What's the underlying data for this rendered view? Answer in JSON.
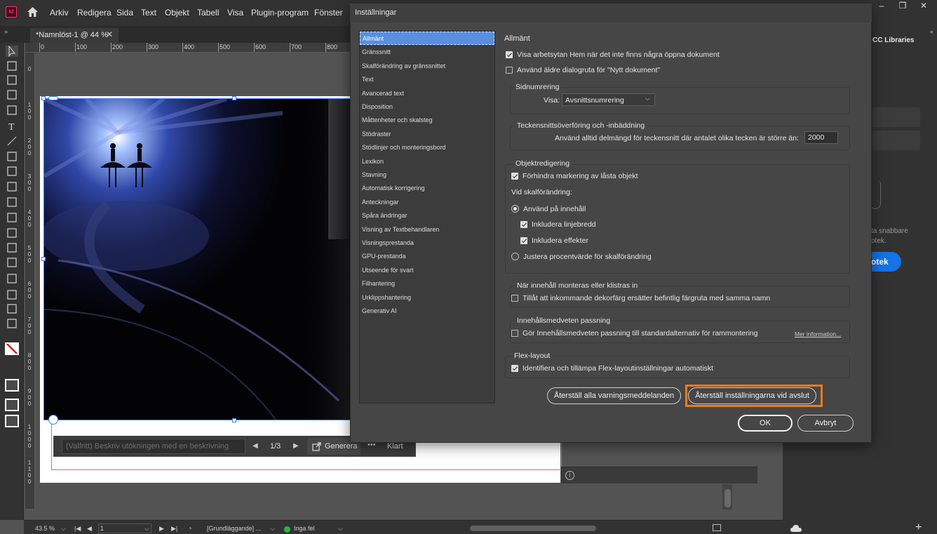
{
  "app": {
    "logo_text": "Id",
    "menus": [
      "Arkiv",
      "Redigera",
      "Sida",
      "Text",
      "Objekt",
      "Tabell",
      "Visa",
      "Plugin-program",
      "Fönster"
    ],
    "window_controls": [
      "–",
      "❐",
      "✕"
    ]
  },
  "doc_tab": {
    "label": "*Namnlöst-1 @ 44 %",
    "close": "✕"
  },
  "rulers": {
    "top": [
      "0",
      "100",
      "200",
      "300",
      "400",
      "500",
      "600",
      "700",
      "800"
    ],
    "left_labels": [
      {
        "label": "0",
        "digits": [
          "0"
        ]
      },
      {
        "label": "100",
        "digits": [
          "1",
          "0",
          "0"
        ]
      },
      {
        "label": "200",
        "digits": [
          "2",
          "0",
          "0"
        ]
      },
      {
        "label": "300",
        "digits": [
          "3",
          "0",
          "0"
        ]
      },
      {
        "label": "400",
        "digits": [
          "4",
          "0",
          "0"
        ]
      },
      {
        "label": "500",
        "digits": [
          "5",
          "0",
          "0"
        ]
      },
      {
        "label": "600",
        "digits": [
          "6",
          "0",
          "0"
        ]
      },
      {
        "label": "700",
        "digits": [
          "7",
          "0",
          "0"
        ]
      },
      {
        "label": "800",
        "digits": [
          "8",
          "0",
          "0"
        ]
      },
      {
        "label": "900",
        "digits": [
          "9",
          "0",
          "0"
        ]
      },
      {
        "label": "1000",
        "digits": [
          "1",
          "0",
          "0",
          "0"
        ]
      },
      {
        "label": "1100",
        "digits": [
          "1",
          "1",
          "0",
          "0"
        ]
      }
    ]
  },
  "gen_bar": {
    "placeholder": "(Valfritt) Beskriv utökningen med en beskrivning",
    "page_indicator": "1/3",
    "generate_label": "Generera",
    "more": "•••",
    "done_label": "Klart"
  },
  "right_panel": {
    "tab_label": "CC Libraries",
    "text_line1": "ta snabbare",
    "text_line2": "otek.",
    "button_label": "otek"
  },
  "statusbar": {
    "zoom": "43.5 %",
    "page": "1",
    "workspace": "[Grundläggande] ...",
    "preflight": "Inga fel"
  },
  "dialog": {
    "title": "Inställningar",
    "categories": [
      "Allmänt",
      "Gränssnitt",
      "Skalförändring av gränssnittet",
      "Text",
      "Avancerad text",
      "Disposition",
      "Måttenheter och skalsteg",
      "Stödraster",
      "Stödlinjer och monteringsbord",
      "Lexikon",
      "Stavning",
      "Automatisk korrigering",
      "Anteckningar",
      "Spåra ändringar",
      "Visning av Textbehandlaren",
      "Visningsprestanda",
      "GPU-prestanda",
      "Utseende för svart",
      "Filhantering",
      "Urklippshantering",
      "Generativ AI"
    ],
    "selected_index": 0,
    "section_title": "Allmänt",
    "opt_home": {
      "label": "Visa arbetsytan Hem när det inte finns några öppna dokument",
      "checked": true
    },
    "opt_legacy": {
      "label": "Använd äldre dialogruta för \"Nytt dokument\"",
      "checked": false
    },
    "page_numbering": {
      "title": "Sidnumrering",
      "view_label": "Visa:",
      "view_value": "Avsnittsnumrering"
    },
    "font_download": {
      "title": "Teckensnittsöverföring och -inbäddning",
      "label": "Använd alltid delmängd för teckensnitt där antalet olika tecken är större än:",
      "value": "2000"
    },
    "object_editing": {
      "title": "Objektredigering",
      "prevent_locked": {
        "label": "Förhindra markering av låsta objekt",
        "checked": true
      },
      "when_scaling": "Vid skalförändring:",
      "apply_content": {
        "label": "Använd på innehåll",
        "checked": true
      },
      "include_stroke": {
        "label": "Inkludera linjebredd",
        "checked": true
      },
      "include_effects": {
        "label": "Inkludera effekter",
        "checked": true
      },
      "adjust_percent": {
        "label": "Justera procentvärde för skalförändring",
        "checked": false
      }
    },
    "paste": {
      "title": "När innehåll monteras eller klistras in",
      "label": "Tillåt att inkommande dekorfärg ersätter befintlig färgruta med samma namn",
      "checked": false
    },
    "content_aware": {
      "title": "Innehållsmedveten passning",
      "label": "Gör Innehållsmedveten passning till standardalternativ för rammontering",
      "checked": false,
      "more_info": "Mer information..."
    },
    "flex": {
      "title": "Flex-layout",
      "label": "Identifiera och tillämpa Flex-layoutinställningar automatiskt",
      "checked": true
    },
    "buttons": {
      "reset_warnings": "Återställ alla varningsmeddelanden",
      "reset_on_exit": "Återställ inställningarna vid avslut",
      "ok": "OK",
      "cancel": "Avbryt"
    }
  },
  "colors": {
    "accent": "#1473e6",
    "highlight": "#f07a1e",
    "selected_item": "#5a8fe0",
    "logo": "#ff3366"
  }
}
